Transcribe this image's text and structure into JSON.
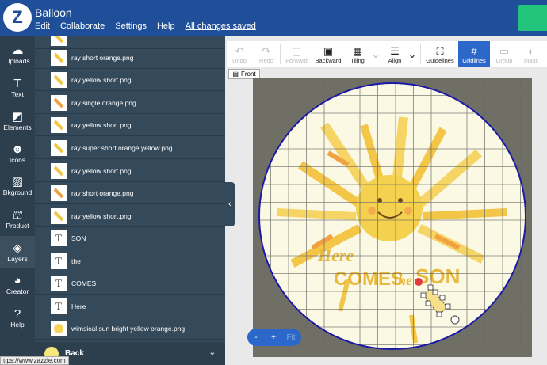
{
  "app": {
    "title": "Balloon",
    "logo": "Z"
  },
  "menu": [
    "Edit",
    "Collaborate",
    "Settings",
    "Help",
    "All changes saved"
  ],
  "rail": [
    {
      "label": "Uploads",
      "icon": "cloud-upload-icon",
      "glyph": "☁"
    },
    {
      "label": "Text",
      "icon": "text-icon",
      "glyph": "T"
    },
    {
      "label": "Elements",
      "icon": "elements-icon",
      "glyph": "◩"
    },
    {
      "label": "Icons",
      "icon": "icons-icon",
      "glyph": "☻"
    },
    {
      "label": "Bkground",
      "icon": "background-icon",
      "glyph": "▨"
    },
    {
      "label": "Product",
      "icon": "product-icon",
      "glyph": "⛫"
    },
    {
      "label": "Layers",
      "icon": "layers-icon",
      "glyph": "◈"
    },
    {
      "label": "Creator",
      "icon": "creator-icon",
      "glyph": "◕"
    },
    {
      "label": "Help",
      "icon": "help-icon",
      "glyph": "?"
    }
  ],
  "layers": [
    {
      "label": "",
      "kind": "ray"
    },
    {
      "label": "ray short orange.png",
      "kind": "ray"
    },
    {
      "label": "ray yellow short.png",
      "kind": "ray"
    },
    {
      "label": "ray single orange.png",
      "kind": "ray-orange"
    },
    {
      "label": "ray yellow short.png",
      "kind": "ray"
    },
    {
      "label": "ray super short orange yellow.png",
      "kind": "ray"
    },
    {
      "label": "ray yellow short.png",
      "kind": "ray"
    },
    {
      "label": "ray short orange.png",
      "kind": "ray"
    },
    {
      "label": "ray yellow short.png",
      "kind": "ray"
    },
    {
      "label": "SON",
      "kind": "text"
    },
    {
      "label": "the",
      "kind": "text"
    },
    {
      "label": "COMES",
      "kind": "text"
    },
    {
      "label": "Here",
      "kind": "text"
    },
    {
      "label": "wimsical sun bright yellow orange.png",
      "kind": "sun"
    }
  ],
  "text_thumb_glyph": "T",
  "back_label": "Back",
  "status_url": "ttps://www.zazzle.com",
  "toolbar": [
    {
      "label": "Undo",
      "icon": "undo-icon",
      "glyph": "↶",
      "state": "disabled"
    },
    {
      "label": "Redo",
      "icon": "redo-icon",
      "glyph": "↷",
      "state": "disabled"
    },
    {
      "label": "Forward",
      "icon": "forward-icon",
      "glyph": "▢",
      "state": "disabled"
    },
    {
      "label": "Backward",
      "icon": "backward-icon",
      "glyph": "▣",
      "state": "normal"
    },
    {
      "label": "Tiling",
      "icon": "tiling-icon",
      "glyph": "▦",
      "state": "normal"
    },
    {
      "label": "",
      "icon": "chevron-down-icon",
      "glyph": "⌄",
      "state": "disabled"
    },
    {
      "label": "Align",
      "icon": "align-icon",
      "glyph": "☰",
      "state": "normal"
    },
    {
      "label": "",
      "icon": "chevron-down-icon",
      "glyph": "⌄",
      "state": "normal"
    },
    {
      "label": "Guidelines",
      "icon": "guidelines-icon",
      "glyph": "⛶",
      "state": "normal"
    },
    {
      "label": "Gridlines",
      "icon": "gridlines-icon",
      "glyph": "#",
      "state": "active"
    },
    {
      "label": "Group",
      "icon": "group-icon",
      "glyph": "▭",
      "state": "disabled"
    },
    {
      "label": "Mask",
      "icon": "mask-icon",
      "glyph": "◐",
      "state": "disabled"
    }
  ],
  "front_label": "Front",
  "artwork": {
    "line1": "Here",
    "line2": "COMES",
    "line3": "the",
    "line4": "SON"
  },
  "zoom": {
    "minus": "-",
    "plus": "+",
    "fit": "Fit"
  },
  "colors": {
    "brand": "#1f4f98",
    "accent": "#2c68c9",
    "panel": "#34495a",
    "sun": "#f3c648",
    "ray_orange": "#f0a240"
  }
}
